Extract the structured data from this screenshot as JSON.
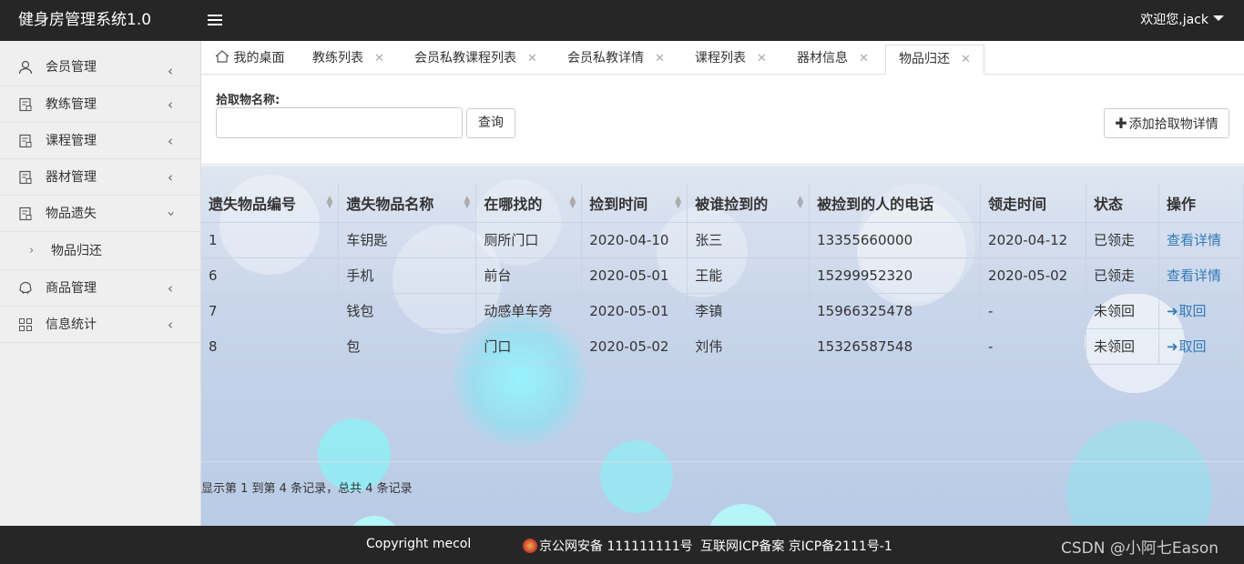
{
  "app": {
    "title": "健身房管理系统1.0",
    "user_label": "欢迎您,jack"
  },
  "sidebar": {
    "items": [
      {
        "label": "会员管理",
        "icon": "user-icon"
      },
      {
        "label": "教练管理",
        "icon": "document-icon"
      },
      {
        "label": "课程管理",
        "icon": "document-icon"
      },
      {
        "label": "器材管理",
        "icon": "document-icon"
      },
      {
        "label": "物品遗失",
        "icon": "document-icon",
        "expanded": true
      },
      {
        "label": "商品管理",
        "icon": "cart-icon"
      },
      {
        "label": "信息统计",
        "icon": "grid-icon"
      }
    ],
    "sub_item": {
      "label": "物品归还"
    }
  },
  "tabs": [
    {
      "label": "我的桌面",
      "icon": "home-icon"
    },
    {
      "label": "教练列表"
    },
    {
      "label": "会员私教课程列表"
    },
    {
      "label": "会员私教详情"
    },
    {
      "label": "课程列表"
    },
    {
      "label": "器材信息"
    },
    {
      "label": "物品归还",
      "active": true
    }
  ],
  "search": {
    "label": "拾取物名称:",
    "value": "",
    "query_button": "查询",
    "add_button": "添加拾取物详情"
  },
  "table": {
    "headers": [
      "遗失物品编号",
      "遗失物品名称",
      "在哪找的",
      "捡到时间",
      "被谁捡到的",
      "被捡到的人的电话",
      "领走时间",
      "状态",
      "操作"
    ],
    "rows": [
      {
        "id": "1",
        "name": "车钥匙",
        "place": "厕所门口",
        "found_time": "2020-04-10",
        "finder": "张三",
        "phone": "13355660000",
        "taken_time": "2020-04-12",
        "status": "已领走",
        "action": "查看详情"
      },
      {
        "id": "6",
        "name": "手机",
        "place": "前台",
        "found_time": "2020-05-01",
        "finder": "王能",
        "phone": "15299952320",
        "taken_time": "2020-05-02",
        "status": "已领走",
        "action": "查看详情"
      },
      {
        "id": "7",
        "name": "钱包",
        "place": "动感单车旁",
        "found_time": "2020-05-01",
        "finder": "李镇",
        "phone": "15966325478",
        "taken_time": "-",
        "status": "未领回",
        "action": "取回"
      },
      {
        "id": "8",
        "name": "包",
        "place": "门口",
        "found_time": "2020-05-02",
        "finder": "刘伟",
        "phone": "15326587548",
        "taken_time": "-",
        "status": "未领回",
        "action": "取回"
      }
    ]
  },
  "pager": {
    "info": "显示第 1 到第 4 条记录，总共 4 条记录"
  },
  "footer": {
    "copyright": "Copyright mecol",
    "police": "京公网安备 111111111号",
    "icp": "互联网ICP备案 京ICP备2111号-1",
    "watermark": "CSDN @小阿七Eason"
  },
  "colors": {
    "topbar": "#262626",
    "sidebar": "#efefef",
    "link": "#337ab7"
  }
}
